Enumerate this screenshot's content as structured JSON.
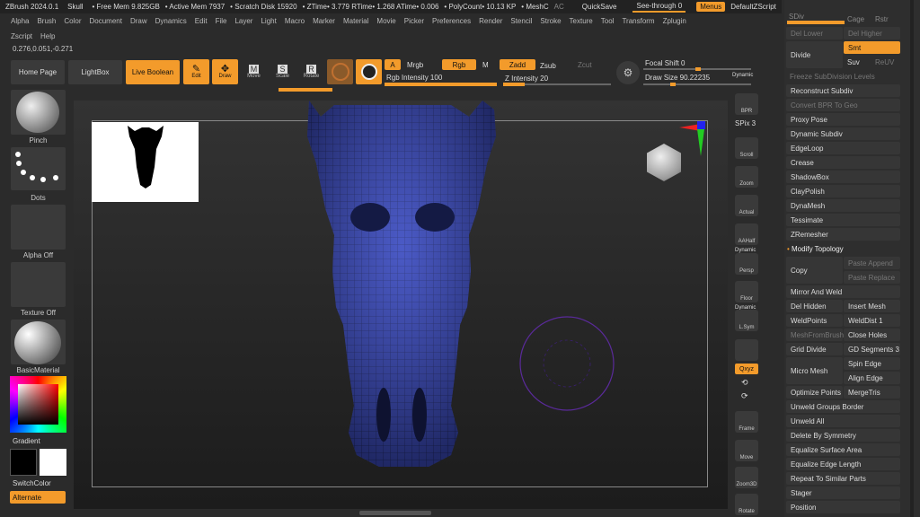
{
  "titlebar": {
    "app": "ZBrush 2024.0.1",
    "project": "Skull",
    "free_mem": "• Free Mem 9.825GB",
    "active_mem": "• Active Mem 7937",
    "scratch": "• Scratch Disk 15920",
    "timing": "• ZTime• 3.779 RTime• 1.268 ATime• 0.006",
    "polycount": "• PolyCount• 10.13 KP",
    "meshc": "• MeshC",
    "ac": "AC",
    "quicksave": "QuickSave",
    "seethrough": "See-through  0",
    "menus": "Menus",
    "script": "DefaultZScript"
  },
  "menubar": [
    "Alpha",
    "Brush",
    "Color",
    "Document",
    "Draw",
    "Dynamics",
    "Edit",
    "File",
    "Layer",
    "Light",
    "Macro",
    "Marker",
    "Material",
    "Movie",
    "Picker",
    "Preferences",
    "Render",
    "Stencil",
    "Stroke",
    "Texture",
    "Tool",
    "Transform",
    "Zplugin"
  ],
  "menubar2": [
    "Zscript",
    "Help"
  ],
  "coords": "0.276,0.051,-0.271",
  "toolbar": {
    "home": "Home Page",
    "lightbox": "LightBox",
    "liveboolean": "Live Boolean",
    "edit": "Edit",
    "draw": "Draw",
    "move": "Move",
    "scale": "Scale",
    "rotate": "Rotate",
    "a": "A",
    "mrgb": "Mrgb",
    "rgb": "Rgb",
    "m": "M",
    "zadd": "Zadd",
    "zsub": "Zsub",
    "zcut": "Zcut",
    "rgb_intensity": "Rgb Intensity 100",
    "z_intensity": "Z Intensity 20",
    "focal_shift": "Focal Shift 0",
    "draw_size": "Draw Size 90.22235",
    "dynamic": "Dynamic",
    "rgb_intensity_value": 1.0,
    "z_intensity_value": 0.2
  },
  "leftshelf": {
    "brush": "Pinch",
    "stroke": "Dots",
    "alpha": "Alpha Off",
    "texture": "Texture Off",
    "material": "BasicMaterial",
    "gradient": "Gradient",
    "switchcolor": "SwitchColor",
    "alternate": "Alternate"
  },
  "rightdock": [
    {
      "id": "bpr",
      "label": "BPR"
    },
    {
      "id": "spix",
      "label": "SPix 3"
    },
    {
      "id": "scroll",
      "label": "Scroll"
    },
    {
      "id": "zoom",
      "label": "Zoom"
    },
    {
      "id": "actual",
      "label": "Actual"
    },
    {
      "id": "aahalf",
      "label": "AAHalf"
    },
    {
      "id": "dynamic",
      "label": "Dynamic"
    },
    {
      "id": "persp",
      "label": "Persp"
    },
    {
      "id": "floor",
      "label": "Floor"
    },
    {
      "id": "dynamic2",
      "label": "Dynamic"
    },
    {
      "id": "lsym",
      "label": "L.Sym"
    },
    {
      "id": "xyz",
      "label": "Qxyz"
    },
    {
      "id": "frame",
      "label": "Frame"
    },
    {
      "id": "move",
      "label": "Move"
    },
    {
      "id": "zoom3d",
      "label": "Zoom3D"
    },
    {
      "id": "rotate",
      "label": "Rotate"
    }
  ],
  "rpanel": {
    "sdiv": "SDiv",
    "cage": "Cage",
    "rstr": "Rstr",
    "del_lower": "Del Lower",
    "del_higher": "Del Higher",
    "divide": "Divide",
    "smt": "Smt",
    "suv": "Suv",
    "reuv": "ReUV",
    "freeze": "Freeze SubDivision Levels",
    "reconstruct": "Reconstruct Subdiv",
    "convert_bpr": "Convert BPR To Geo",
    "items_a": [
      "Proxy Pose",
      "Dynamic Subdiv",
      "EdgeLoop",
      "Crease",
      "ShadowBox",
      "ClayPolish",
      "DynaMesh",
      "Tessimate",
      "ZRemesher"
    ],
    "modify_topology": "Modify Topology",
    "copy": "Copy",
    "paste_append": "Paste Append",
    "paste_replace": "Paste Replace",
    "mirror_weld": "Mirror And Weld",
    "del_hidden": "Del Hidden",
    "insert_mesh": "Insert Mesh",
    "weld_points": "WeldPoints",
    "weld_dist": "WeldDist 1",
    "mesh_from_brush": "MeshFromBrush",
    "close_holes": "Close Holes",
    "grid_divide": "Grid Divide",
    "gd_segments": "GD Segments 3",
    "micro_mesh": "Micro Mesh",
    "spin_edge": "Spin Edge",
    "align_edge": "Align Edge",
    "optimize_points": "Optimize Points",
    "merge_tris": "MergeTris",
    "items_b": [
      "Unweld Groups Border",
      "Unweld All",
      "Delete By Symmetry",
      "Equalize Surface Area",
      "Equalize Edge Length",
      "Repeat To Similar Parts",
      "Stager",
      "Position"
    ]
  }
}
